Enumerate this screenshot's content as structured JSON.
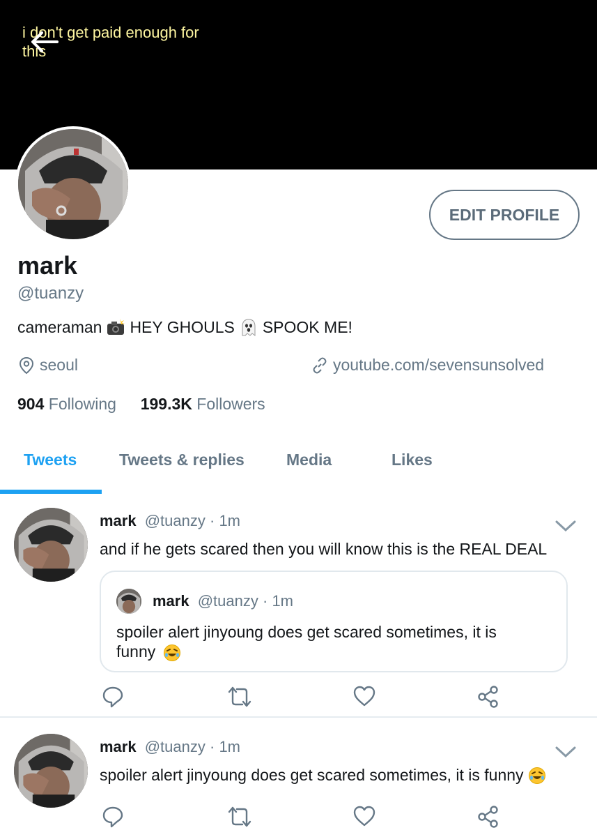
{
  "header": {
    "title": "i don't get paid enough for this",
    "back_icon": "arrow-left-icon"
  },
  "profile": {
    "name": "mark",
    "handle": "@tuanzy",
    "edit_label": "EDIT PROFILE",
    "bio": {
      "part1": "cameraman",
      "part2": "HEY GHOULS",
      "part3": "SPOOK ME!"
    },
    "location": "seoul",
    "website": "youtube.com/sevensunsolved",
    "following_count": "904",
    "following_label": "Following",
    "followers_count": "199.3K",
    "followers_label": "Followers"
  },
  "tabs": [
    {
      "label": "Tweets"
    },
    {
      "label": "Tweets & replies"
    },
    {
      "label": "Media"
    },
    {
      "label": "Likes"
    }
  ],
  "tweets": [
    {
      "name": "mark",
      "handle": "@tuanzy",
      "time": "· 1m",
      "text": "and if he gets scared then you will know this is the REAL DEAL",
      "quote": {
        "name": "mark",
        "handle": "@tuanzy",
        "time": "· 1m",
        "text": "spoiler alert jinyoung does get scared sometimes, it is funny"
      }
    },
    {
      "name": "mark",
      "handle": "@tuanzy",
      "time": "· 1m",
      "text": "spoiler alert jinyoung does get scared sometimes, it is funny"
    }
  ],
  "colors": {
    "accent": "#1da1f2",
    "secondary_text": "#657786",
    "header_bg": "#000000"
  }
}
